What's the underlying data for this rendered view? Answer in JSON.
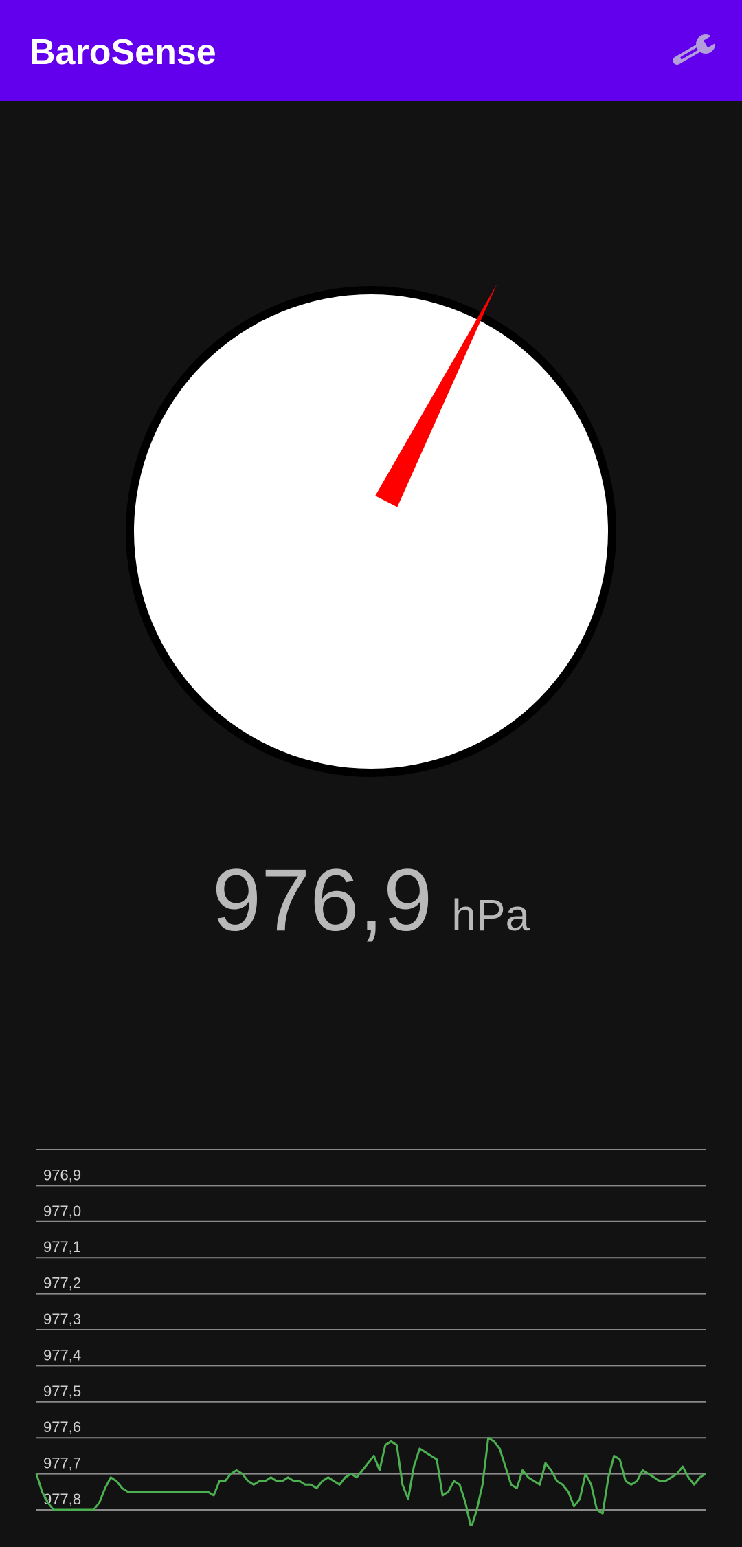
{
  "app": {
    "title": "BaroSense",
    "settings_icon": "wrench-icon"
  },
  "colors": {
    "appbar": "#6200EE",
    "background": "#121212",
    "needle": "#FF0000",
    "gauge_face": "#FFFFFF",
    "gauge_ring": "#000000",
    "reading_text": "#B9B9B9",
    "chart_line": "#4CAF50",
    "chart_grid": "#8A8A8A"
  },
  "gauge": {
    "needle_angle_deg": 27
  },
  "reading": {
    "value": "976,9",
    "unit": "hPa"
  },
  "chart_data": {
    "type": "line",
    "title": "",
    "xlabel": "",
    "ylabel": "",
    "y_tick_labels": [
      "976,9",
      "977,0",
      "977,1",
      "977,2",
      "977,3",
      "977,4",
      "977,5",
      "977,6",
      "977,7",
      "977,8"
    ],
    "ylim": [
      976.85,
      977.8
    ],
    "y_inverted": true,
    "grid": true,
    "legend": "none",
    "series": [
      {
        "values": [
          977.7,
          977.75,
          977.78,
          977.8,
          977.8,
          977.8,
          977.8,
          977.8,
          977.8,
          977.8,
          977.8,
          977.78,
          977.74,
          977.71,
          977.72,
          977.74,
          977.75,
          977.75,
          977.75,
          977.75,
          977.75,
          977.75,
          977.75,
          977.75,
          977.75,
          977.75,
          977.75,
          977.75,
          977.75,
          977.75,
          977.75,
          977.76,
          977.72,
          977.72,
          977.7,
          977.69,
          977.7,
          977.72,
          977.73,
          977.72,
          977.72,
          977.71,
          977.72,
          977.72,
          977.71,
          977.72,
          977.72,
          977.73,
          977.73,
          977.74,
          977.72,
          977.71,
          977.72,
          977.73,
          977.71,
          977.7,
          977.71,
          977.69,
          977.67,
          977.65,
          977.69,
          977.62,
          977.61,
          977.62,
          977.73,
          977.77,
          977.68,
          977.63,
          977.64,
          977.65,
          977.66,
          977.76,
          977.75,
          977.72,
          977.73,
          977.78,
          977.85,
          977.8,
          977.73,
          977.6,
          977.61,
          977.63,
          977.68,
          977.73,
          977.74,
          977.69,
          977.71,
          977.72,
          977.73,
          977.67,
          977.69,
          977.72,
          977.73,
          977.75,
          977.79,
          977.77,
          977.7,
          977.73,
          977.8,
          977.81,
          977.71,
          977.65,
          977.66,
          977.72,
          977.73,
          977.72,
          977.69,
          977.7,
          977.71,
          977.72,
          977.72,
          977.71,
          977.7,
          977.68,
          977.71,
          977.73,
          977.71,
          977.7
        ]
      }
    ]
  }
}
